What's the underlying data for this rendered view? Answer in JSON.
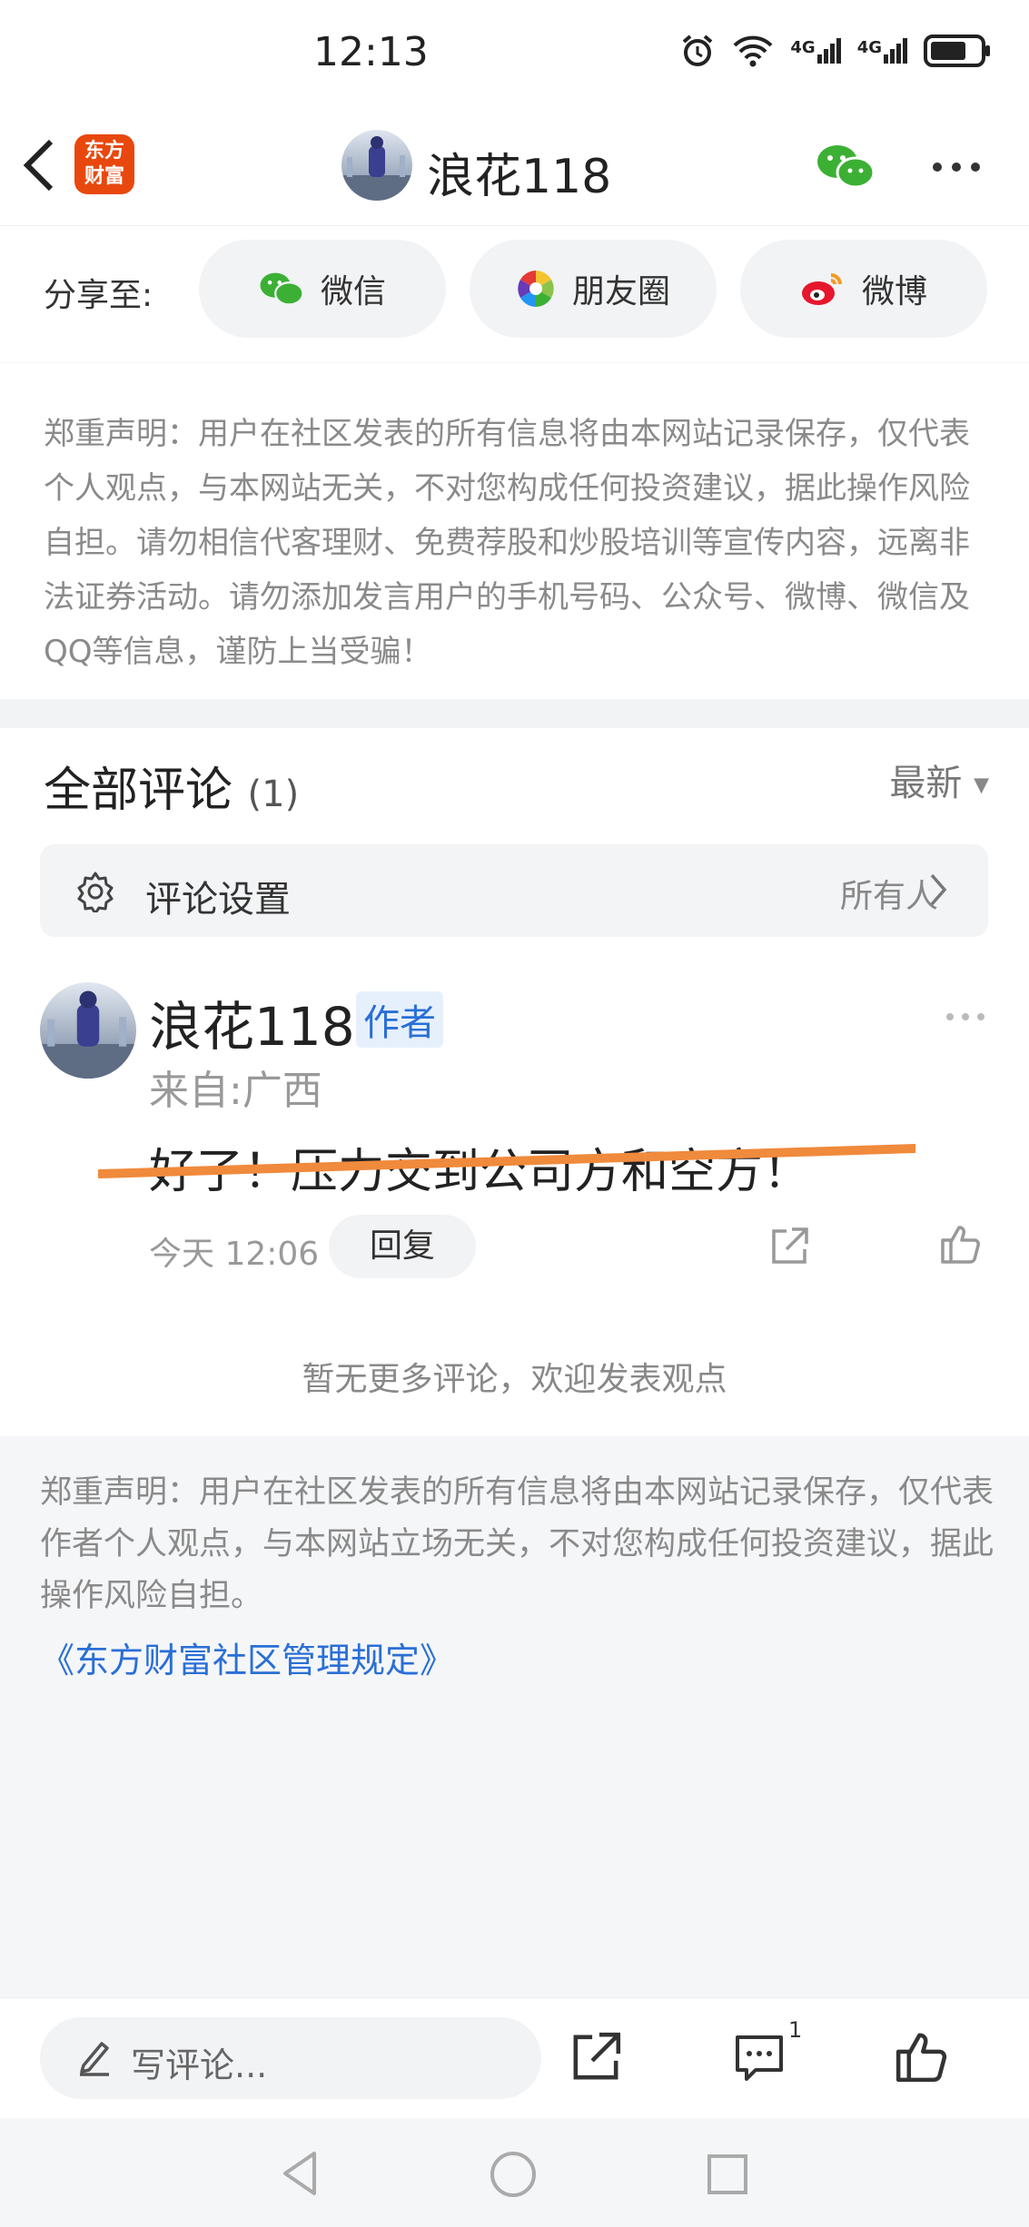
{
  "status_bar": {
    "time": "12:13",
    "signal1": "4G",
    "signal2": "4G"
  },
  "header": {
    "logo_line1": "东方",
    "logo_line2": "财富",
    "title": "浪花118"
  },
  "share": {
    "label": "分享至:",
    "buttons": [
      {
        "label": "微信",
        "icon": "wechat-icon"
      },
      {
        "label": "朋友圈",
        "icon": "moments-icon"
      },
      {
        "label": "微博",
        "icon": "weibo-icon"
      }
    ]
  },
  "disclaimer_top": "郑重声明：用户在社区发表的所有信息将由本网站记录保存，仅代表个人观点，与本网站无关，不对您构成任何投资建议，据此操作风险自担。请勿相信代客理财、免费荐股和炒股培训等宣传内容，远离非法证券活动。请勿添加发言用户的手机号码、公众号、微博、微信及QQ等信息，谨防上当受骗！",
  "comments": {
    "title": "全部评论",
    "count": "(1)",
    "sort_label": "最新",
    "settings_label": "评论设置",
    "settings_value": "所有人",
    "items": [
      {
        "name": "浪花118",
        "tag": "作者",
        "location": "来自:广西",
        "text": "好了！压力交到公司方和空方！",
        "time": "今天 12:06",
        "reply_label": "回复"
      }
    ],
    "no_more": "暂无更多评论，欢迎发表观点"
  },
  "disclaimer_bottom": "郑重声明：用户在社区发表的所有信息将由本网站记录保存，仅代表作者个人观点，与本网站立场无关，不对您构成任何投资建议，据此操作风险自担。",
  "rules_link": "《东方财富社区管理规定》",
  "bottom_bar": {
    "placeholder": "写评论...",
    "comment_badge": "1"
  },
  "colors": {
    "brand": "#e8480e",
    "link": "#2a6fd6",
    "strike": "#f08a3c",
    "wechat": "#3cb034"
  }
}
